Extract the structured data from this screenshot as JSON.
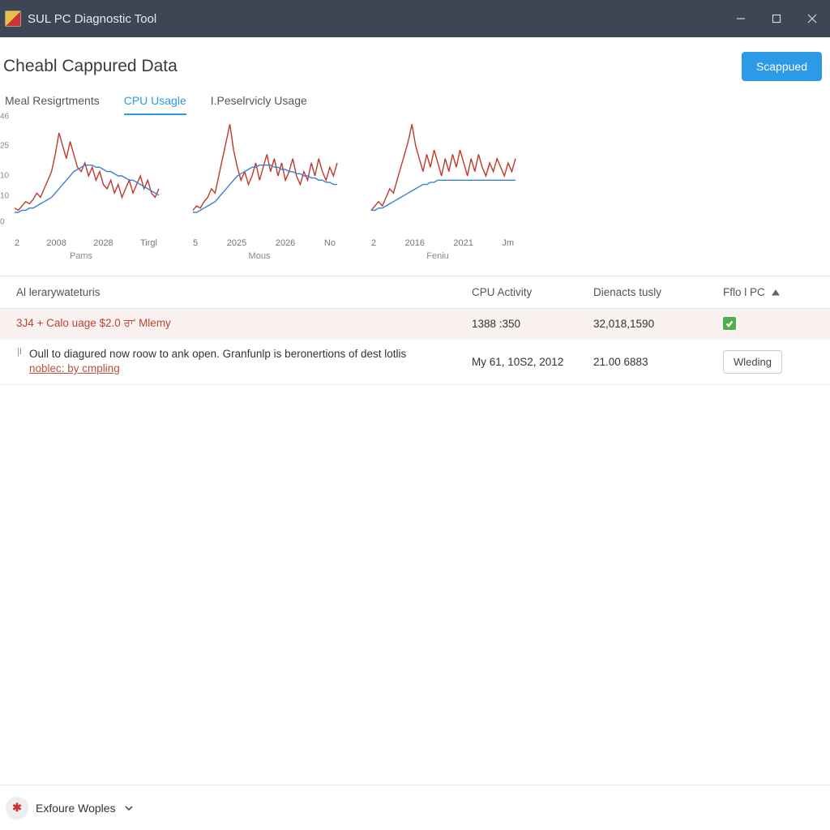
{
  "window": {
    "title": "SUL PC  Diagnostic Tool"
  },
  "header": {
    "page_title": "Cheabl Cappured Data",
    "primary_button": "Scappued"
  },
  "tabs": [
    {
      "label": "Meal Resigrtments",
      "active": false
    },
    {
      "label": "CPU Usagle",
      "active": true
    },
    {
      "label": "I.Peselrvicly Usage",
      "active": false
    }
  ],
  "chart_data": [
    {
      "type": "line",
      "xlabel": "Pams",
      "x_ticks": [
        "2",
        "2008",
        "2028",
        "Tirgl"
      ],
      "y_ticks": [
        "46",
        "25",
        "10",
        "10",
        "0"
      ],
      "ylim": [
        0,
        46
      ],
      "series": [
        {
          "name": "red",
          "color": "#c0392b",
          "values": [
            5,
            4,
            6,
            8,
            7,
            9,
            12,
            10,
            14,
            18,
            22,
            30,
            40,
            34,
            28,
            36,
            30,
            24,
            22,
            26,
            20,
            24,
            18,
            22,
            16,
            14,
            18,
            12,
            16,
            10,
            14,
            18,
            12,
            16,
            20,
            14,
            18,
            12,
            10,
            14
          ]
        },
        {
          "name": "blue",
          "color": "#3b7fd1",
          "values": [
            3,
            3,
            4,
            4,
            5,
            5,
            6,
            7,
            8,
            9,
            10,
            12,
            14,
            16,
            18,
            20,
            22,
            23,
            24,
            25,
            25,
            25,
            24,
            24,
            23,
            22,
            22,
            21,
            20,
            20,
            19,
            18,
            18,
            17,
            16,
            15,
            14,
            13,
            12,
            11
          ]
        }
      ]
    },
    {
      "type": "line",
      "xlabel": "Mous",
      "x_ticks": [
        "5",
        "2025",
        "2026",
        "No"
      ],
      "y_ticks": [
        "46",
        "25",
        "10",
        "10",
        "0"
      ],
      "ylim": [
        0,
        46
      ],
      "series": [
        {
          "name": "red",
          "color": "#c0392b",
          "values": [
            4,
            6,
            5,
            8,
            10,
            14,
            12,
            20,
            28,
            36,
            44,
            32,
            24,
            18,
            22,
            16,
            20,
            26,
            18,
            24,
            30,
            22,
            28,
            20,
            26,
            18,
            22,
            28,
            20,
            16,
            22,
            18,
            26,
            20,
            28,
            22,
            18,
            24,
            20,
            26
          ]
        },
        {
          "name": "blue",
          "color": "#3b7fd1",
          "values": [
            3,
            3,
            4,
            5,
            6,
            7,
            8,
            10,
            12,
            14,
            16,
            18,
            20,
            21,
            22,
            23,
            24,
            24,
            25,
            25,
            25,
            25,
            24,
            24,
            23,
            23,
            22,
            22,
            21,
            21,
            20,
            20,
            19,
            19,
            18,
            18,
            17,
            17,
            16,
            16
          ]
        }
      ]
    },
    {
      "type": "line",
      "xlabel": "Feniu",
      "x_ticks": [
        "2",
        "2016",
        "2021",
        "Jm"
      ],
      "y_ticks": [
        "46",
        "25",
        "10",
        "10",
        "0"
      ],
      "ylim": [
        0,
        46
      ],
      "series": [
        {
          "name": "red",
          "color": "#c0392b",
          "values": [
            4,
            6,
            8,
            6,
            10,
            14,
            12,
            18,
            24,
            30,
            36,
            44,
            34,
            28,
            22,
            30,
            24,
            32,
            26,
            20,
            28,
            22,
            30,
            24,
            32,
            26,
            20,
            28,
            22,
            30,
            24,
            20,
            26,
            22,
            28,
            24,
            20,
            26,
            22,
            28
          ]
        },
        {
          "name": "blue",
          "color": "#3b7fd1",
          "values": [
            4,
            4,
            5,
            5,
            6,
            7,
            8,
            9,
            10,
            11,
            12,
            13,
            14,
            15,
            16,
            16,
            17,
            17,
            18,
            18,
            18,
            18,
            18,
            18,
            18,
            18,
            18,
            18,
            18,
            18,
            18,
            18,
            18,
            18,
            18,
            18,
            18,
            18,
            18,
            18
          ]
        }
      ]
    }
  ],
  "table": {
    "columns": [
      "Al lerarywateturis",
      "CPU Activity",
      "Dienacts tusly",
      "Fflo l PC"
    ],
    "rows": [
      {
        "primary_html": "<span style='color:#b43'>3J4</span> + Calo uage <span style='color:#b43'>$2.0 ਰਾ'</span> Mlemy",
        "cpu": "1388 :350",
        "diag": "32,018,1590",
        "action_type": "check"
      },
      {
        "row_marker": "|I",
        "desc": "Oull to diagured now roow to ank open. Granfunlp is beronertions of dest lotlis",
        "link": "noblec: by cmpling",
        "cpu": "My 61, 10S2, 2012",
        "diag": "21.00 6883",
        "action_type": "button",
        "action_label": "Wleding"
      }
    ]
  },
  "footer": {
    "label": "Exfoure Woples"
  }
}
